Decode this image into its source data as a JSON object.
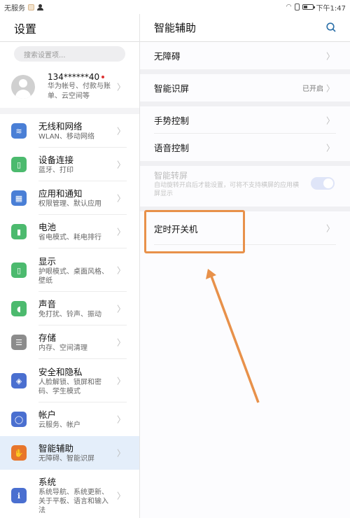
{
  "status_bar": {
    "carrier": "无服务",
    "time": "下午1:47"
  },
  "left_panel": {
    "title": "设置",
    "search_placeholder": "搜索设置项...",
    "account": {
      "name": "134******40",
      "subtitle": "华为帐号、付款与账单、云空间等"
    },
    "items": [
      {
        "title": "无线和网络",
        "subtitle": "WLAN、移动网络",
        "icon": "wifi-icon",
        "color": "#4a7fd6"
      },
      {
        "title": "设备连接",
        "subtitle": "蓝牙、打印",
        "icon": "device-connect-icon",
        "color": "#4cba6e"
      },
      {
        "title": "应用和通知",
        "subtitle": "权限管理、默认应用",
        "icon": "apps-icon",
        "color": "#4a7fd6"
      },
      {
        "title": "电池",
        "subtitle": "省电模式、耗电排行",
        "icon": "battery-icon",
        "color": "#4cba6e"
      },
      {
        "title": "显示",
        "subtitle": "护眼模式、桌面风格、壁纸",
        "icon": "display-icon",
        "color": "#4cba6e"
      },
      {
        "title": "声音",
        "subtitle": "免打扰、铃声、振动",
        "icon": "sound-icon",
        "color": "#4cba6e"
      },
      {
        "title": "存储",
        "subtitle": "内存、空间清理",
        "icon": "storage-icon",
        "color": "#8c8c8c"
      },
      {
        "title": "安全和隐私",
        "subtitle": "人脸解锁、锁屏和密码、学生模式",
        "icon": "shield-icon",
        "color": "#4a6fd0"
      },
      {
        "title": "帐户",
        "subtitle": "云服务、帐户",
        "icon": "account-icon",
        "color": "#4a6fd0"
      },
      {
        "title": "智能辅助",
        "subtitle": "无障碍、智能识屏",
        "icon": "hand-icon",
        "color": "#e8762c",
        "selected": true
      },
      {
        "title": "系统",
        "subtitle": "系统导航、系统更新、关于平板、语言和输入法",
        "icon": "system-info-icon",
        "color": "#4a6fd0"
      }
    ]
  },
  "right_panel": {
    "title": "智能辅助",
    "items": {
      "accessibility": "无障碍",
      "smart_screen": "智能识屏",
      "smart_screen_value": "已开启",
      "gesture_control": "手势控制",
      "voice_control": "语音控制",
      "smart_rotate_title": "智能转屏",
      "smart_rotate_desc": "自动旋转开启后才能设置，可将不支持横屏的应用横屏显示",
      "smart_rotate_on": true,
      "scheduled_power": "定时开关机"
    }
  },
  "annotation": {
    "color": "#e8914a",
    "target": "定时开关机"
  }
}
